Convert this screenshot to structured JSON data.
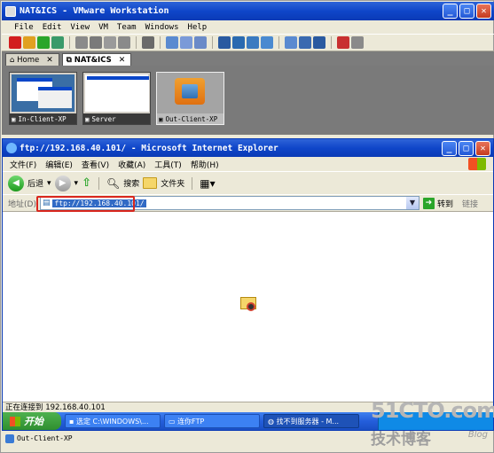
{
  "vmware": {
    "title": "NAT&ICS - VMware Workstation",
    "menu": [
      "File",
      "Edit",
      "View",
      "VM",
      "Team",
      "Windows",
      "Help"
    ],
    "tabs": [
      {
        "label": "Home",
        "active": false
      },
      {
        "label": "NAT&ICS",
        "active": true
      }
    ],
    "thumbnails": [
      {
        "label": "In-Client-XP"
      },
      {
        "label": "Server"
      },
      {
        "label": "Out-Client-XP"
      }
    ],
    "status": "Out-Client-XP"
  },
  "ie": {
    "title": "ftp://192.168.40.101/ - Microsoft Internet Explorer",
    "menu": [
      "文件(F)",
      "编辑(E)",
      "查看(V)",
      "收藏(A)",
      "工具(T)",
      "帮助(H)"
    ],
    "toolbar": {
      "back_label": "后退",
      "search_label": "搜索",
      "folders_label": "文件夹"
    },
    "address": {
      "label": "地址(D)",
      "value": "ftp://192.168.40.101/",
      "go_label": "转到",
      "links_label": "链接"
    },
    "status": "正在连接到 192.168.40.101"
  },
  "taskbar": {
    "start_label": "开始",
    "tasks": [
      {
        "label": "选定 C:\\WINDOWS\\...",
        "active": false
      },
      {
        "label": "连你FTP",
        "active": false
      },
      {
        "label": "找不到服务器 - M...",
        "active": true
      }
    ]
  },
  "watermark": {
    "site": "51CTO.com",
    "tagline": "技术博客",
    "blog": "Blog"
  },
  "colors": {
    "titlebar": "#0f46c9",
    "highlight_box": "#d9261c",
    "chrome": "#ece9d8"
  }
}
